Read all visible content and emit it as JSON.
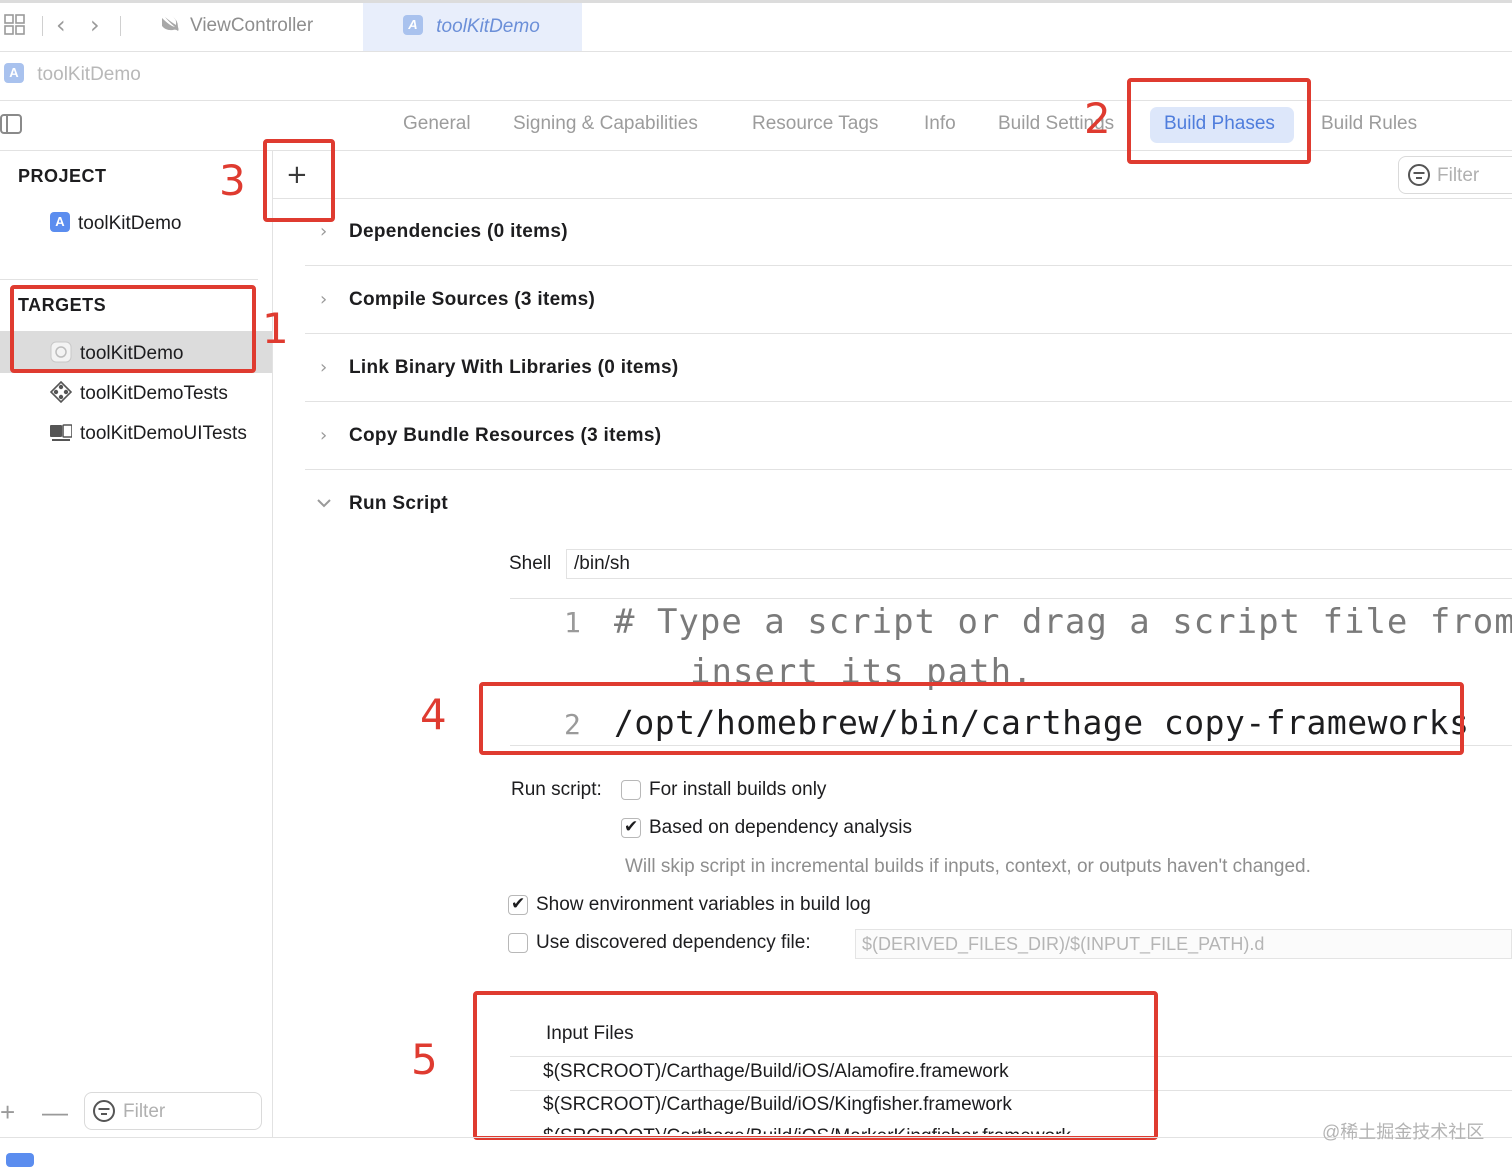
{
  "window": {
    "tabs": [
      {
        "label": "ViewController"
      },
      {
        "label": "toolKitDemo"
      }
    ],
    "breadcrumb": "toolKitDemo"
  },
  "editor_tabs": [
    "General",
    "Signing & Capabilities",
    "Resource Tags",
    "Info",
    "Build Settings",
    "Build Phases",
    "Build Rules"
  ],
  "editor_tabs_active": "Build Phases",
  "filter_placeholder": "Filter",
  "sidebar": {
    "project_header": "PROJECT",
    "project_item": "toolKitDemo",
    "targets_header": "TARGETS",
    "targets": [
      "toolKitDemo",
      "toolKitDemoTests",
      "toolKitDemoUITests"
    ],
    "filter_placeholder": "Filter"
  },
  "phases": {
    "add_label": "+",
    "items": [
      "Dependencies (0 items)",
      "Compile Sources (3 items)",
      "Link Binary With Libraries (0 items)",
      "Copy Bundle Resources (3 items)"
    ],
    "run_script_title": "Run Script"
  },
  "run_script": {
    "shell_label": "Shell",
    "shell_value": "/bin/sh",
    "code": [
      {
        "num": "1",
        "text": "# Type a script or drag a script file from your",
        "cont": "insert its path."
      },
      {
        "num": "2",
        "text": "/opt/homebrew/bin/carthage  copy-frameworks"
      }
    ],
    "run_script_label": "Run script:",
    "install_only_label": "For install builds only",
    "install_only_checked": false,
    "dependency_analysis_label": "Based on dependency analysis",
    "dependency_analysis_checked": true,
    "dependency_hint": "Will skip script in incremental builds if inputs, context, or outputs haven't changed.",
    "show_env_label": "Show environment variables in build log",
    "show_env_checked": true,
    "discovered_dep_label": "Use discovered dependency file:",
    "discovered_dep_checked": false,
    "discovered_dep_placeholder": "$(DERIVED_FILES_DIR)/$(INPUT_FILE_PATH).d",
    "input_files_title": "Input Files",
    "input_files": [
      "$(SRCROOT)/Carthage/Build/iOS/Alamofire.framework",
      "$(SRCROOT)/Carthage/Build/iOS/Kingfisher.framework",
      "$(SRCROOT)/Carthage/Build/iOS/MarkerKingfisher.framework"
    ]
  },
  "annotations": [
    "1",
    "2",
    "3",
    "4",
    "5"
  ],
  "bottom": {
    "plus": "+",
    "minus": "—"
  },
  "watermark": "@稀土掘金技术社区",
  "colors": {
    "accent": "#4f7ddc",
    "annotation_red": "#df3b30",
    "selection": "#dcdcdc"
  }
}
